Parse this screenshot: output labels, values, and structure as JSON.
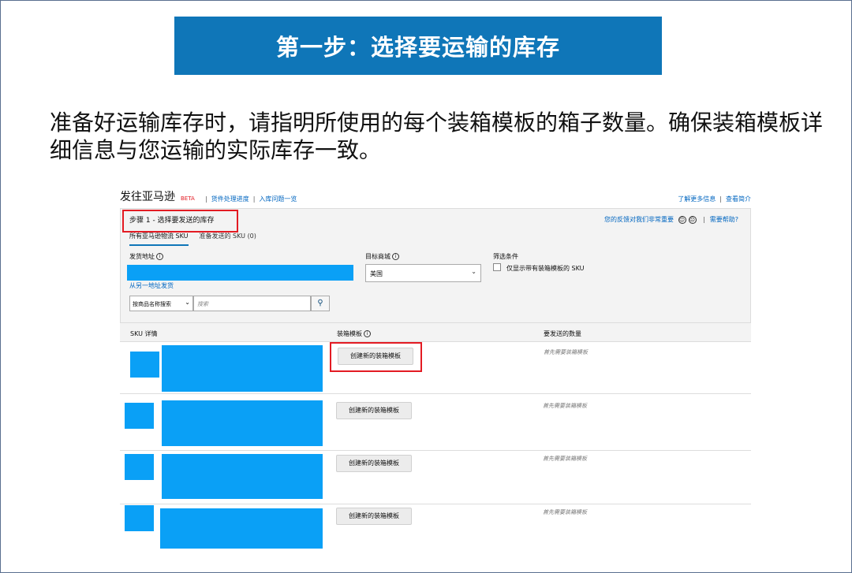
{
  "slide": {
    "banner_title": "第一步：选择要运输的库存",
    "intro_text": "准备好运输库存时，请指明所使用的每个装箱模板的箱子数量。确保装箱模板详细信息与您运输的实际库存一致。"
  },
  "app": {
    "brand": "发往亚马逊",
    "beta": "BETA",
    "nav_links": [
      "货件处理进度",
      "入库问题一览"
    ],
    "nav_right": [
      "了解更多信息",
      "查看简介"
    ]
  },
  "step": {
    "title": "步骤 1 - 选择要发送的库存",
    "feedback": "您的反馈对我们非常重要",
    "help": "需要帮助?",
    "tabs": [
      "所有亚马逊物流 SKU",
      "准备发送的 SKU (0)"
    ]
  },
  "form": {
    "ship_from_label": "发货地址",
    "ship_other_link": "从另一地址发货",
    "marketplace_label": "目标商城",
    "marketplace_value": "美国",
    "filter_label": "筛选条件",
    "filter_option": "仅显示带有装箱模板的 SKU",
    "search_by": "按商品名称搜索",
    "search_placeholder": "搜索"
  },
  "table": {
    "headers": [
      "SKU 详情",
      "装箱模板",
      "要发送的数量"
    ],
    "rows": [
      {
        "button": "创建新的装箱模板",
        "qty_note": "首先需要装箱模板"
      },
      {
        "button": "创建新的装箱模板",
        "qty_note": "首先需要装箱模板"
      },
      {
        "button": "创建新的装箱模板",
        "qty_note": "首先需要装箱模板"
      },
      {
        "button": "创建新的装箱模板",
        "qty_note": "首先需要装箱模板"
      }
    ]
  },
  "colors": {
    "banner_bg": "#0f76b8",
    "redaction": "#0aa0f6",
    "highlight": "#e31b23",
    "link": "#0066c0"
  }
}
